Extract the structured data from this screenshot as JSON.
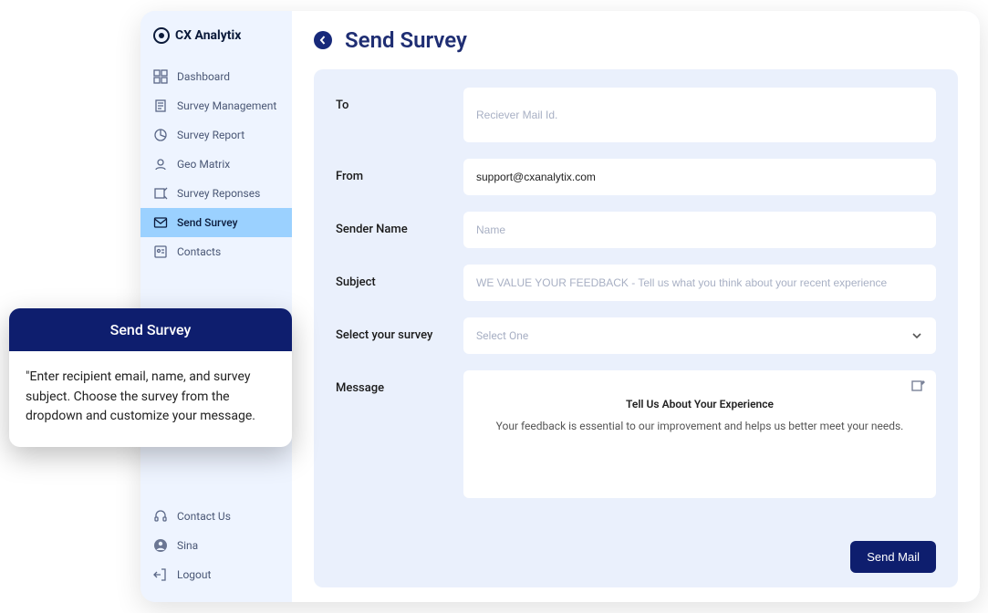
{
  "brand": {
    "name": "CX Analytix"
  },
  "sidebar": {
    "items": [
      {
        "label": "Dashboard"
      },
      {
        "label": "Survey Management"
      },
      {
        "label": "Survey Report"
      },
      {
        "label": "Geo Matrix"
      },
      {
        "label": "Survey Reponses"
      },
      {
        "label": "Send Survey"
      },
      {
        "label": "Contacts"
      }
    ],
    "bottom": [
      {
        "label": "Contact Us"
      },
      {
        "label": "Sina"
      },
      {
        "label": "Logout"
      }
    ]
  },
  "page": {
    "title": "Send Survey"
  },
  "form": {
    "to": {
      "label": "To",
      "placeholder": "Reciever Mail Id.",
      "value": ""
    },
    "from": {
      "label": "From",
      "value": "support@cxanalytix.com"
    },
    "sender": {
      "label": "Sender Name",
      "placeholder": "Name",
      "value": ""
    },
    "subject": {
      "label": "Subject",
      "placeholder": "WE VALUE YOUR FEEDBACK - Tell us what you think about your recent experience",
      "value": ""
    },
    "survey": {
      "label": "Select your survey",
      "placeholder": "Select One"
    },
    "message": {
      "label": "Message",
      "title": "Tell Us About Your Experience",
      "body": "Your feedback is essential to our improvement and helps us better meet your needs."
    },
    "send_label": "Send Mail"
  },
  "callout": {
    "title": "Send Survey",
    "body": "\"Enter recipient email, name, and survey subject. Choose the survey from the dropdown and customize your message."
  }
}
